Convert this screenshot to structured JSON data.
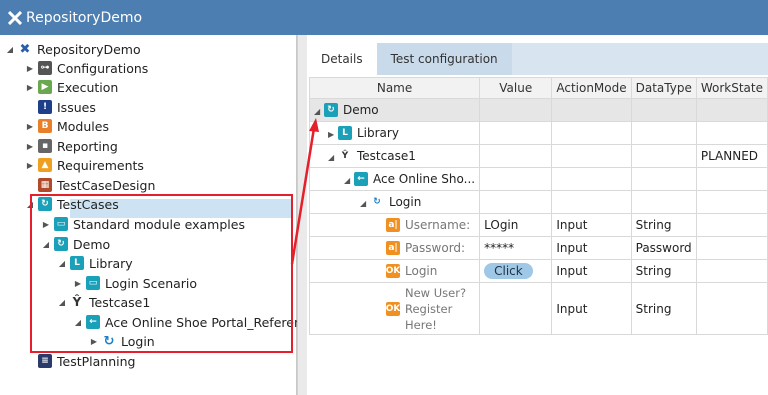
{
  "window": {
    "title": "RepositoryDemo"
  },
  "tree": {
    "root": "RepositoryDemo",
    "items": [
      {
        "label": "Configurations",
        "icon": "configurations-icon"
      },
      {
        "label": "Execution",
        "icon": "execution-icon"
      },
      {
        "label": "Issues",
        "icon": "issues-icon"
      },
      {
        "label": "Modules",
        "icon": "modules-icon"
      },
      {
        "label": "Reporting",
        "icon": "reporting-icon"
      },
      {
        "label": "Requirements",
        "icon": "requirements-icon"
      },
      {
        "label": "TestCaseDesign",
        "icon": "testcasedesign-icon"
      },
      {
        "label": "TestCases",
        "icon": "testcases-icon"
      },
      {
        "label": "Standard module examples",
        "icon": "folder-icon"
      },
      {
        "label": "Demo",
        "icon": "folder-icon"
      },
      {
        "label": "Library",
        "icon": "library-icon"
      },
      {
        "label": "Login Scenario",
        "icon": "folder-icon"
      },
      {
        "label": "Testcase1",
        "icon": "testcase-icon"
      },
      {
        "label": "Ace Online Shoe Portal_Reference",
        "icon": "reference-icon"
      },
      {
        "label": "Login",
        "icon": "refresh-icon"
      },
      {
        "label": "TestPlanning",
        "icon": "testplanning-icon"
      }
    ]
  },
  "tabs": [
    {
      "label": "Details"
    },
    {
      "label": "Test configuration"
    }
  ],
  "grid": {
    "columns": [
      "Name",
      "Value",
      "ActionMode",
      "DataType",
      "WorkState"
    ],
    "rows": [
      {
        "name": "Demo",
        "value": "",
        "action": "",
        "type": "",
        "state": ""
      },
      {
        "name": "Library",
        "value": "",
        "action": "",
        "type": "",
        "state": ""
      },
      {
        "name": "Testcase1",
        "value": "",
        "action": "",
        "type": "",
        "state": "PLANNED"
      },
      {
        "name": "Ace Online Sho...",
        "value": "",
        "action": "",
        "type": "",
        "state": ""
      },
      {
        "name": "Login",
        "value": "",
        "action": "",
        "type": "",
        "state": ""
      },
      {
        "name": "Username:",
        "value": "LOgin",
        "action": "Input",
        "type": "String",
        "state": ""
      },
      {
        "name": "Password:",
        "value": "*****",
        "action": "Input",
        "type": "Password",
        "state": ""
      },
      {
        "name": "Login",
        "value": "Click",
        "action": "Input",
        "type": "String",
        "state": ""
      },
      {
        "name": "New User? Register Here!",
        "name_lines": [
          "New User?",
          "Register",
          "Here!"
        ],
        "value": "",
        "action": "Input",
        "type": "String",
        "state": ""
      }
    ]
  },
  "colors": {
    "titlebar": "#4c7eb2",
    "highlight": "#e5202a",
    "selection": "#cde3f3"
  }
}
